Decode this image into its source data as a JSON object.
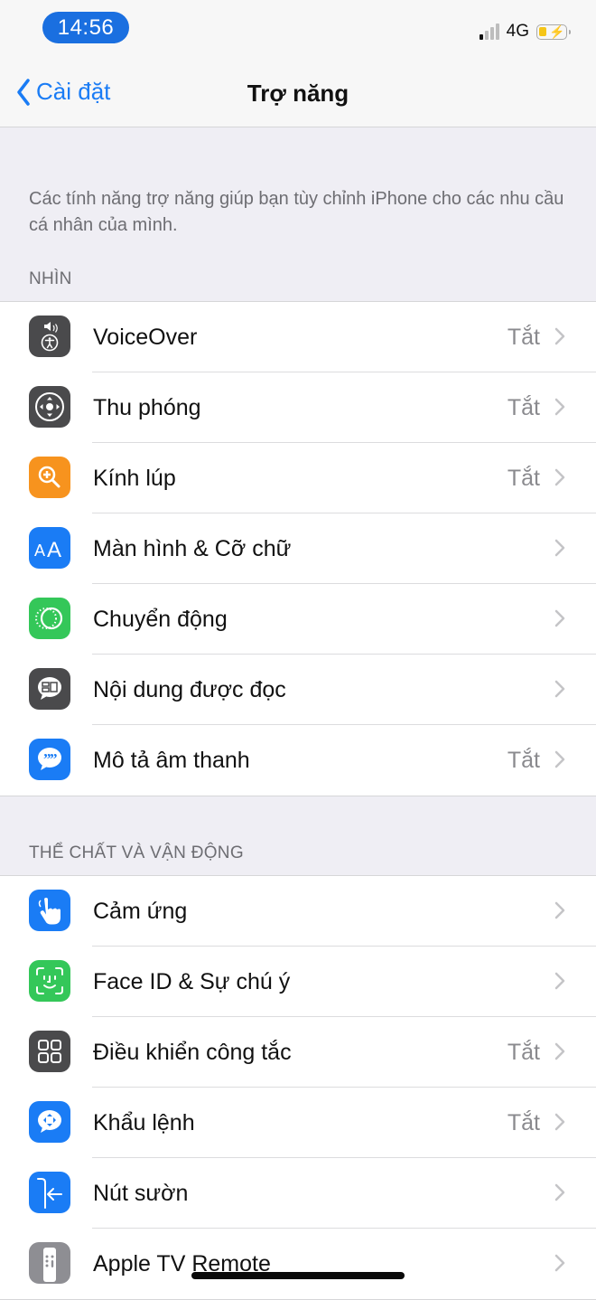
{
  "status_bar": {
    "time": "14:56",
    "network": "4G",
    "signal_bars_active": 1,
    "signal_bars_total": 4,
    "battery_state": "charging",
    "battery_color": "#f5c518"
  },
  "nav": {
    "back_label": "Cài đặt",
    "title": "Trợ năng",
    "accent_color": "#1a7cf5"
  },
  "description": "Các tính năng trợ năng giúp bạn tùy chỉnh iPhone cho các nhu cầu cá nhân của mình.",
  "sections": [
    {
      "header": "NHÌN",
      "items": [
        {
          "label": "VoiceOver",
          "value": "Tắt",
          "icon": "voiceover-icon",
          "icon_color": "#4a4a4c"
        },
        {
          "label": "Thu phóng",
          "value": "Tắt",
          "icon": "zoom-icon",
          "icon_color": "#4a4a4c"
        },
        {
          "label": "Kính lúp",
          "value": "Tắt",
          "icon": "magnifier-icon",
          "icon_color": "#f7931e"
        },
        {
          "label": "Màn hình & Cỡ chữ",
          "value": "",
          "icon": "text-size-icon",
          "icon_color": "#1a7cf5"
        },
        {
          "label": "Chuyển động",
          "value": "",
          "icon": "motion-icon",
          "icon_color": "#34c759"
        },
        {
          "label": "Nội dung được đọc",
          "value": "",
          "icon": "spoken-content-icon",
          "icon_color": "#4a4a4c"
        },
        {
          "label": "Mô tả âm thanh",
          "value": "Tắt",
          "icon": "audio-description-icon",
          "icon_color": "#1a7cf5"
        }
      ]
    },
    {
      "header": "THỂ CHẤT VÀ VẬN ĐỘNG",
      "items": [
        {
          "label": "Cảm ứng",
          "value": "",
          "icon": "touch-icon",
          "icon_color": "#1a7cf5"
        },
        {
          "label": "Face ID & Sự chú ý",
          "value": "",
          "icon": "face-id-icon",
          "icon_color": "#34c759"
        },
        {
          "label": "Điều khiển công tắc",
          "value": "Tắt",
          "icon": "switch-control-icon",
          "icon_color": "#4a4a4c"
        },
        {
          "label": "Khẩu lệnh",
          "value": "Tắt",
          "icon": "voice-control-icon",
          "icon_color": "#1a7cf5"
        },
        {
          "label": "Nút sườn",
          "value": "",
          "icon": "side-button-icon",
          "icon_color": "#1a7cf5"
        },
        {
          "label": "Apple TV Remote",
          "value": "",
          "icon": "apple-tv-remote-icon",
          "icon_color": "#8e8e93"
        }
      ]
    }
  ]
}
